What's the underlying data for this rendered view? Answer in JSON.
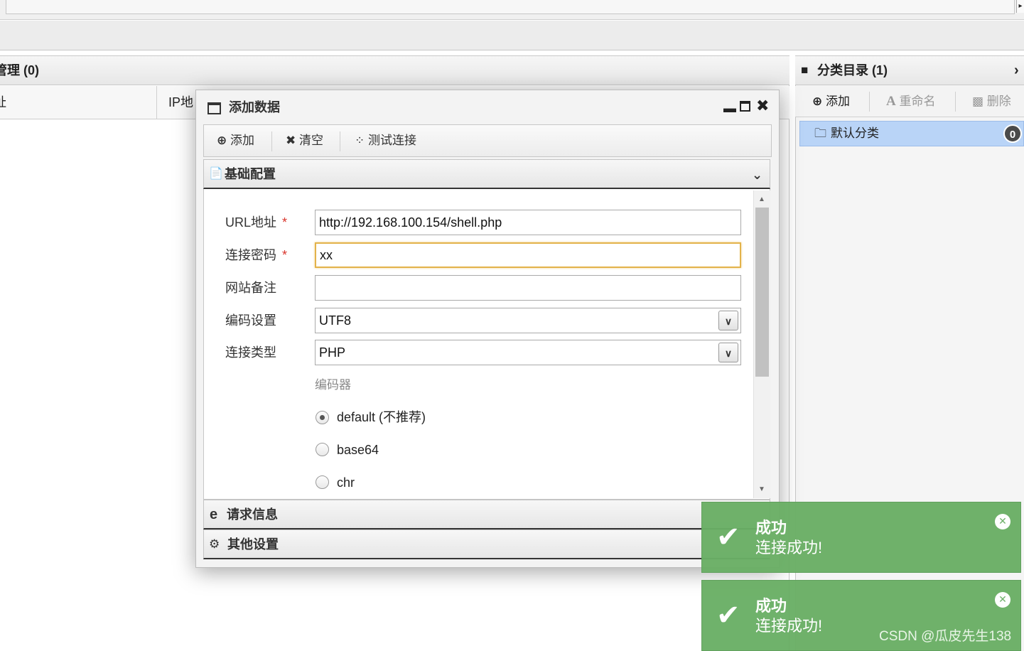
{
  "left_panel": {
    "title_fragment": "管理 (0)",
    "columns": [
      "址",
      "IP地"
    ]
  },
  "right_panel": {
    "title": "分类目录 (1)",
    "toolbar": {
      "add": "添加",
      "rename": "重命名",
      "delete": "删除"
    },
    "categories": [
      {
        "name": "默认分类",
        "count": "0"
      }
    ]
  },
  "dialog": {
    "title": "添加数据",
    "toolbar": {
      "add": "添加",
      "clear": "清空",
      "test": "测试连接"
    },
    "sections": {
      "basic": "基础配置",
      "request": "请求信息",
      "other": "其他设置"
    },
    "form": {
      "url_label": "URL地址",
      "url_value": "http://192.168.100.154/shell.php",
      "password_label": "连接密码",
      "password_value": "xx",
      "note_label": "网站备注",
      "note_value": "",
      "encoding_label": "编码设置",
      "encoding_value": "UTF8",
      "type_label": "连接类型",
      "type_value": "PHP",
      "encoder_label": "编码器",
      "required_mark": "*",
      "encoders": [
        {
          "label": "default (不推荐)",
          "selected": true
        },
        {
          "label": "base64",
          "selected": false
        },
        {
          "label": "chr",
          "selected": false
        }
      ]
    }
  },
  "toasts": [
    {
      "title": "成功",
      "message": "连接成功!"
    },
    {
      "title": "成功",
      "message": "连接成功!"
    }
  ],
  "watermark": "CSDN @瓜皮先生138",
  "colors": {
    "toast_green": "#6aaf65",
    "selection_blue": "#b9d4f7",
    "focus_border": "#e3b34a",
    "required_red": "#d9342b"
  }
}
